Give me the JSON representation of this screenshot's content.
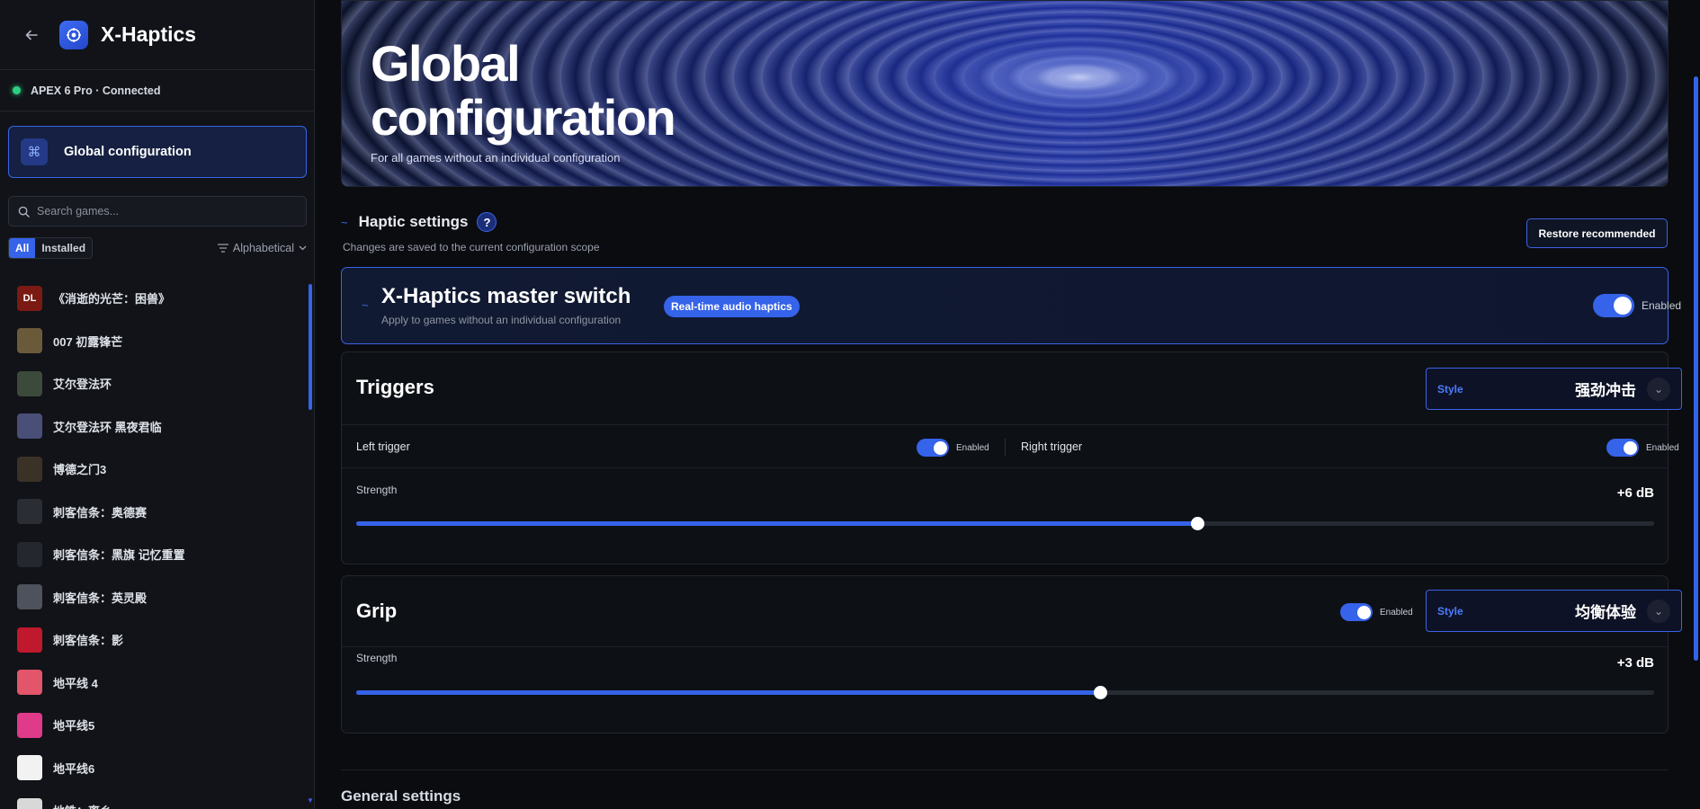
{
  "app": {
    "title": "X-Haptics",
    "device_status": "APEX 6 Pro · Connected"
  },
  "sidebar": {
    "global_config_label": "Global configuration",
    "search_placeholder": "Search games...",
    "filter_all": "All",
    "filter_installed": "Installed",
    "sort_label": "Alphabetical",
    "games": [
      {
        "name": "《消逝的光芒：困兽》",
        "thumb": "DL",
        "color": "#7a1a12"
      },
      {
        "name": "007 初露锋芒",
        "thumb": "",
        "color": "#6b5a3a"
      },
      {
        "name": "艾尔登法环",
        "thumb": "",
        "color": "#3b4a3a"
      },
      {
        "name": "艾尔登法环 黑夜君临",
        "thumb": "",
        "color": "#4a4f78"
      },
      {
        "name": "博德之门3",
        "thumb": "",
        "color": "#3a3226"
      },
      {
        "name": "刺客信条：奥德赛",
        "thumb": "",
        "color": "#2a2d33"
      },
      {
        "name": "刺客信条：黑旗 记忆重置",
        "thumb": "",
        "color": "#24272d"
      },
      {
        "name": "刺客信条：英灵殿",
        "thumb": "",
        "color": "#4d525c"
      },
      {
        "name": "刺客信条：影",
        "thumb": "",
        "color": "#c0182c"
      },
      {
        "name": "地平线 4",
        "thumb": "",
        "color": "#e2556a"
      },
      {
        "name": "地平线5",
        "thumb": "",
        "color": "#e03a8a"
      },
      {
        "name": "地平线6",
        "thumb": "",
        "color": "#f2f2f2"
      },
      {
        "name": "地铁：离乡",
        "thumb": "",
        "color": "#d8d8d8"
      }
    ]
  },
  "hero": {
    "title_line1": "Global",
    "title_line2": "configuration",
    "subtitle": "For all games without an individual configuration"
  },
  "haptic": {
    "title": "Haptic settings",
    "help": "?",
    "subtitle": "Changes are saved to the current configuration scope",
    "restore_label": "Restore recommended"
  },
  "master": {
    "title": "X-Haptics master switch",
    "subtitle": "Apply to games without an individual configuration",
    "pill": "Real-time audio haptics",
    "toggle_label": "Enabled",
    "enabled": true
  },
  "triggers": {
    "title": "Triggers",
    "style_key": "Style",
    "style_value": "强劲冲击",
    "left_label": "Left trigger",
    "left_toggle": "Enabled",
    "right_label": "Right trigger",
    "right_toggle": "Enabled",
    "strength_label": "Strength",
    "strength_value": "+6 dB",
    "strength_fraction": 0.648
  },
  "grip": {
    "title": "Grip",
    "toggle_label": "Enabled",
    "style_key": "Style",
    "style_value": "均衡体验",
    "strength_label": "Strength",
    "strength_value": "+3 dB",
    "strength_fraction": 0.573
  },
  "general": {
    "title": "General settings"
  },
  "colors": {
    "accent": "#3563e9",
    "status_connected": "#2ccf7f"
  }
}
